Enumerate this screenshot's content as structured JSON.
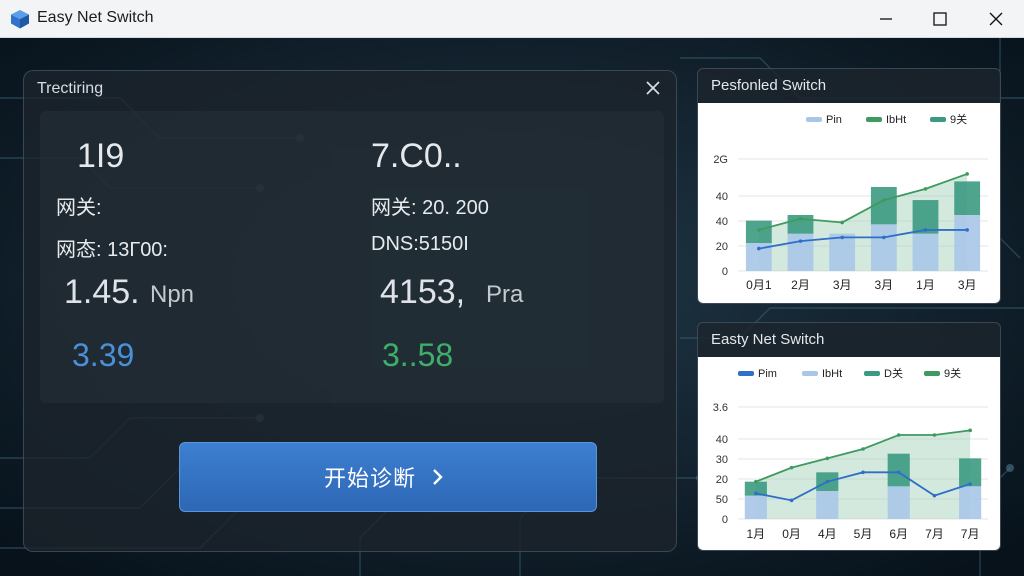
{
  "window": {
    "title": "Easy Net Switch"
  },
  "panel": {
    "title": "Trectiring",
    "left": {
      "value_top": "1I9",
      "gateway": "网关:",
      "status": "网态: 13Г00:",
      "speed_value": "1.45.",
      "speed_unit": "Npn",
      "metric": "3.39"
    },
    "right": {
      "value_top": "7.C0..",
      "gateway": "网关: 20. 200",
      "dns": "DNS:5150I",
      "speed_value": "4153,",
      "speed_unit": "Pra",
      "metric": "3..58"
    },
    "button_label": "开始诊断",
    "button_arrow": "›"
  },
  "colors": {
    "accent_blue": "#3b7bd0",
    "green": "#2e9a64",
    "metric_left": "#4a8fd8",
    "metric_right": "#3fae6a",
    "bar_light": "#a9c6e8",
    "bar_teal": "#3c9a82",
    "line_blue": "#2f6fc8",
    "line_green": "#3e9a5e"
  },
  "chart_data": [
    {
      "type": "bar",
      "title": "Pesfonled Switch",
      "legend": [
        "Pin",
        "IbHt",
        "9关"
      ],
      "legend_position": "top-right",
      "y_ticks": [
        "0",
        "20",
        "40",
        "40",
        "2G"
      ],
      "x_ticks": [
        "0月1",
        "2月",
        "3月",
        "3月",
        "1月",
        "3月"
      ],
      "categories": [
        "0月1",
        "2月",
        "3月",
        "3月",
        "1月",
        "3月"
      ],
      "series": [
        {
          "name": "Pin",
          "kind": "bar",
          "values": [
            15,
            20,
            20,
            25,
            20,
            30
          ]
        },
        {
          "name": "9关",
          "kind": "bar",
          "values": [
            12,
            10,
            0,
            20,
            18,
            18
          ]
        },
        {
          "name": "IbHt",
          "kind": "line",
          "values": [
            22,
            28,
            26,
            38,
            44,
            52
          ]
        },
        {
          "name": "",
          "kind": "line",
          "values": [
            12,
            16,
            18,
            18,
            22,
            22
          ]
        }
      ],
      "ylim": [
        0,
        60
      ],
      "grid": true
    },
    {
      "type": "bar",
      "title": "Easty Net Switch",
      "legend": [
        "Pim",
        "IbHt",
        "D关",
        "9关"
      ],
      "legend_position": "top-right",
      "y_ticks": [
        "0",
        "50",
        "20",
        "30",
        "40",
        "3.6"
      ],
      "x_ticks": [
        "1月",
        "0月",
        "4月",
        "5月",
        "6月",
        "7月",
        "7月"
      ],
      "categories": [
        "1月",
        "0月",
        "4月",
        "5月",
        "6月",
        "7月",
        "7月"
      ],
      "series": [
        {
          "name": "Pim",
          "kind": "bar",
          "values": [
            10,
            0,
            12,
            0,
            14,
            0,
            14
          ]
        },
        {
          "name": "9关",
          "kind": "bar",
          "values": [
            6,
            0,
            8,
            0,
            14,
            0,
            12
          ]
        },
        {
          "name": "IbHt",
          "kind": "line",
          "values": [
            16,
            22,
            26,
            30,
            36,
            36,
            38
          ]
        },
        {
          "name": "Pim",
          "kind": "line",
          "values": [
            11,
            8,
            16,
            20,
            20,
            10,
            15
          ]
        }
      ],
      "ylim": [
        0,
        48
      ],
      "grid": true
    }
  ]
}
